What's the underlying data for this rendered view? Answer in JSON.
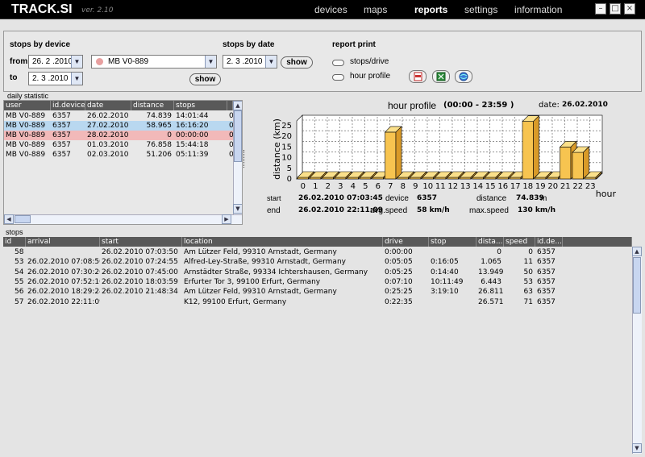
{
  "app": {
    "title": "TRACK.SI",
    "version": "ver. 2.10"
  },
  "nav": [
    "devices",
    "maps",
    "reports",
    "settings",
    "information"
  ],
  "nav_active": "reports",
  "window_buttons": {
    "minimize": "–",
    "maximize": "□",
    "close": "×"
  },
  "by_device": {
    "title": "stops by device",
    "from_label": "from",
    "from_value": "26. 2 .2010",
    "to_label": "to",
    "to_value": "2. 3 .2010",
    "device_value": "MB V0-889",
    "show_label": "show"
  },
  "by_date": {
    "title": "stops by date",
    "date_value": "2. 3 .2010",
    "show_label": "show"
  },
  "report_print": {
    "title": "report print",
    "option1": "stops/drive",
    "option2": "hour profile",
    "icons": [
      "pdf-icon",
      "excel-icon",
      "web-icon"
    ]
  },
  "daily": {
    "title": "daily statistic",
    "columns": [
      "user",
      "id.device",
      "date",
      "distance",
      "stops",
      ""
    ],
    "rows": [
      {
        "user": "MB V0-889",
        "device": "6357",
        "date": "26.02.2010",
        "distance": "74.839",
        "stops": "14:01:44",
        "extra": "0",
        "highlight": "none"
      },
      {
        "user": "MB V0-889",
        "device": "6357",
        "date": "27.02.2010",
        "distance": "58.965",
        "stops": "16:16:20",
        "extra": "0",
        "highlight": "blue"
      },
      {
        "user": "MB V0-889",
        "device": "6357",
        "date": "28.02.2010",
        "distance": "0",
        "stops": "00:00:00",
        "extra": "0",
        "highlight": "red"
      },
      {
        "user": "MB V0-889",
        "device": "6357",
        "date": "01.03.2010",
        "distance": "76.858",
        "stops": "15:44:18",
        "extra": "0",
        "highlight": "none"
      },
      {
        "user": "MB V0-889",
        "device": "6357",
        "date": "02.03.2010",
        "distance": "51.206",
        "stops": "05:11:39",
        "extra": "0",
        "highlight": "none"
      }
    ]
  },
  "chart_data": {
    "type": "bar",
    "title": "hour profile",
    "time_range": "(00:00 - 23:59 )",
    "date_label": "date:",
    "date_value": "26.02.2010",
    "ylabel": "distance (km)",
    "xlabel": "hour",
    "ylim": [
      0,
      25
    ],
    "yticks": [
      0,
      5,
      10,
      15,
      20,
      25
    ],
    "categories": [
      "0",
      "1",
      "2",
      "3",
      "4",
      "5",
      "6",
      "7",
      "8",
      "9",
      "10",
      "11",
      "12",
      "13",
      "14",
      "15",
      "16",
      "17",
      "18",
      "19",
      "20",
      "21",
      "22",
      "23"
    ],
    "values": [
      0,
      0,
      0,
      0,
      0,
      0,
      0,
      22,
      0,
      0,
      0,
      0,
      0,
      0,
      0,
      0,
      0,
      0,
      27,
      0,
      0,
      15,
      12.5,
      0
    ],
    "bar_color": "#f7c450",
    "grid": true
  },
  "chart_info": {
    "start_label": "start",
    "start_value": "26.02.2010 07:03:45",
    "end_label": "end",
    "end_value": "26.02.2010 22:11:09",
    "device_label": "device",
    "device_value": "6357",
    "avgspeed_label": "avg.speed",
    "avgspeed_value": "58 km/h",
    "distance_label": "distance",
    "distance_value": "74.839",
    "distance_unit": "m",
    "maxspeed_label": "max.speed",
    "maxspeed_value": "130 km/h"
  },
  "stops": {
    "title": "stops",
    "columns": [
      "id",
      "arrival",
      "start",
      "location",
      "drive",
      "stop",
      "dista...",
      "speed",
      "id.de..."
    ],
    "rows": [
      {
        "id": "58",
        "arrival": "",
        "start": "26.02.2010 07:03:50",
        "location": "Am Lützer Feld, 99310 Arnstadt, Germany",
        "drive": "0:00:00",
        "stop": "",
        "distance": "0",
        "speed": "0",
        "device": "6357"
      },
      {
        "id": "53",
        "arrival": "26.02.2010 07:08:50",
        "start": "26.02.2010 07:24:55",
        "location": "Alfred-Ley-Straße, 99310 Arnstadt, Germany",
        "drive": "0:05:05",
        "stop": "0:16:05",
        "distance": "1.065",
        "speed": "11",
        "device": "6357"
      },
      {
        "id": "54",
        "arrival": "26.02.2010 07:30:20",
        "start": "26.02.2010 07:45:00",
        "location": "Arnstädter Straße, 99334 Ichtershausen, Germany",
        "drive": "0:05:25",
        "stop": "0:14:40",
        "distance": "13.949",
        "speed": "50",
        "device": "6357"
      },
      {
        "id": "55",
        "arrival": "26.02.2010 07:52:10",
        "start": "26.02.2010 18:03:59",
        "location": "Erfurter Tor 3, 99100 Erfurt, Germany",
        "drive": "0:07:10",
        "stop": "10:11:49",
        "distance": "6.443",
        "speed": "53",
        "device": "6357"
      },
      {
        "id": "56",
        "arrival": "26.02.2010 18:29:24",
        "start": "26.02.2010 21:48:34",
        "location": "Am Lützer Feld, 99310 Arnstadt, Germany",
        "drive": "0:25:25",
        "stop": "3:19:10",
        "distance": "26.811",
        "speed": "63",
        "device": "6357"
      },
      {
        "id": "57",
        "arrival": "26.02.2010 22:11:09",
        "start": "",
        "location": "K12, 99100 Erfurt, Germany",
        "drive": "0:22:35",
        "stop": "",
        "distance": "26.571",
        "speed": "71",
        "device": "6357"
      }
    ]
  }
}
